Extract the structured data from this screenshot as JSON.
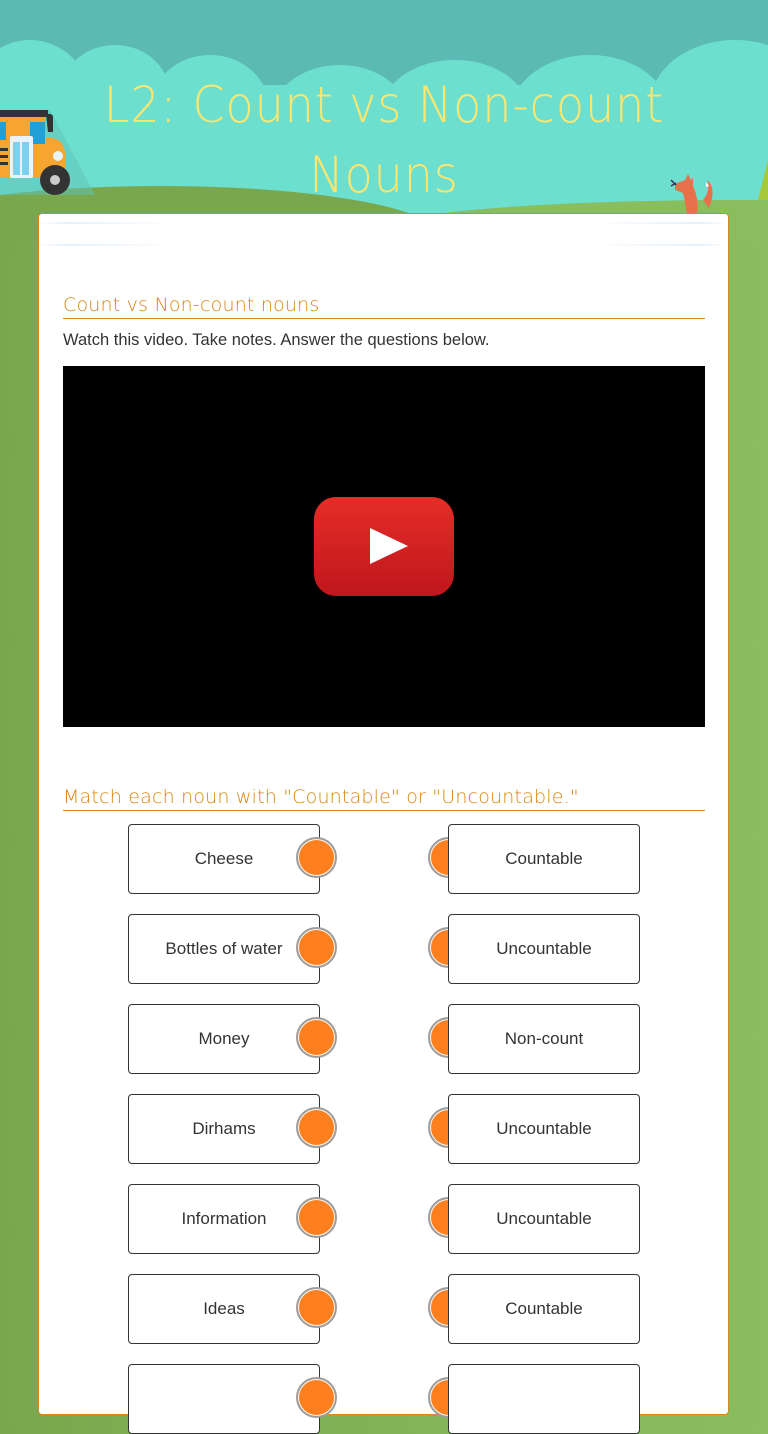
{
  "header": {
    "title": "L2: Count vs Non-count Nouns",
    "decorations": [
      "school-bus-illustration",
      "fox-illustration",
      "clouds",
      "hills"
    ]
  },
  "sections": [
    {
      "title": "Count vs Non-count nouns",
      "instructions": "Watch this video. Take notes. Answer the questions below.",
      "video": {
        "play_icon": "youtube-play-icon"
      }
    },
    {
      "title": "Match each noun with \"Countable\" or \"Uncountable.\"",
      "pairs": [
        {
          "left": "Cheese",
          "right": "Countable"
        },
        {
          "left": "Bottles of water",
          "right": "Uncountable"
        },
        {
          "left": "Money",
          "right": "Non-count"
        },
        {
          "left": "Dirhams",
          "right": "Uncountable"
        },
        {
          "left": "Information",
          "right": "Uncountable"
        },
        {
          "left": "Ideas",
          "right": "Countable"
        },
        {
          "left": "",
          "right": ""
        }
      ]
    }
  ],
  "colors": {
    "accent": "#d8860f",
    "connector_dot": "#fd7f1e",
    "title": "#ffe66d"
  }
}
